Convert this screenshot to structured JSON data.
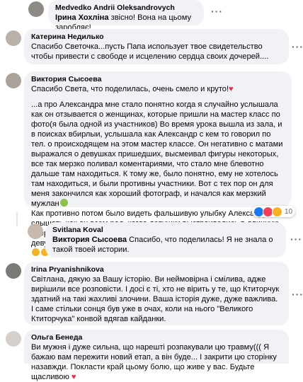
{
  "comments": [
    {
      "author": "Medvedko Andrii Oleksandrovych",
      "mention": "Ірина Хохліна",
      "text": " звісно! Вона на цьому заробляє!"
    },
    {
      "author": "Катерина Недилько",
      "text": "Спасибо Светочка...пусть Папа использует твое свидетельство чтобы привести с свободе и исцелению сердца своих дочерей...."
    },
    {
      "author": "Виктория Сысоева",
      "intro": "Спасибо Света, что поделилась, очень смело и круто!",
      "body": "...а про Александра мне стало понятно когда я случайно услышала как он отзывается о женщинах, которые пришли на мастер класс по фото(я была одной из участников) Во время урока вышла из зала, и в поисках вбирлыи, услышала как Александр с кем то говорил по тел. о происходящем на этом мастер классе. Он негативно с матами выражался о девушках пришедших, высмеивал фигуры некоторых, все так мерзко поливал коментариями, что стало мне блевотно дальше там находиться. К тому же, было понятно, ему не хотелось там находиться, и были противны участники. Вот с тех пор он для меня закончился как хороший фотограф, и начался как мерзкий мужлан",
      "body2": "Как противно потом было видеть фальшивую улыбку Александра, слышать как он всем рад, когда девушки выстраивались в длинную очередь, чтоб сфоткаться с гуру фотографии. И светящиеся глаза девушек, ведь фото, с самим маэстро!...",
      "reactions_count": "10"
    },
    {
      "author": "Svitlana Koval",
      "mention": "Виктория Сысоева",
      "text": " Спасибо, что поделилась! Я не знала о такой твоей истории."
    },
    {
      "author": "Irina Pryanishnikova",
      "text": "Світлана, дякую за Вашу історію. Ви неймовірна і смілива, адже вирішили все розповісти. І досі є ті, хто не вірить у те, що Ктиторчук здатний на такі жахливі злочини. Ваша історія дуже, дуже важлива. І саме стільки сонця був уже в очах, коли на нього \"Великого Ктиторчука\" конвой вдягав кайданки."
    },
    {
      "author": "Ольга Бенеда",
      "text": "Ви мужня і дуже сильна, що нарешті розпакували цю травму((( Я бажаю вам пережити новий етап, а він буде... І закрити цю сторінку назавжди. Покласти край цьому болю, що живе у вас. Будьте щасливою"
    }
  ],
  "menu_icon": "three-dots-icon",
  "colors": {
    "bubble": "#f0f2f5",
    "like": "#1877f2",
    "love": "#f33e58"
  }
}
